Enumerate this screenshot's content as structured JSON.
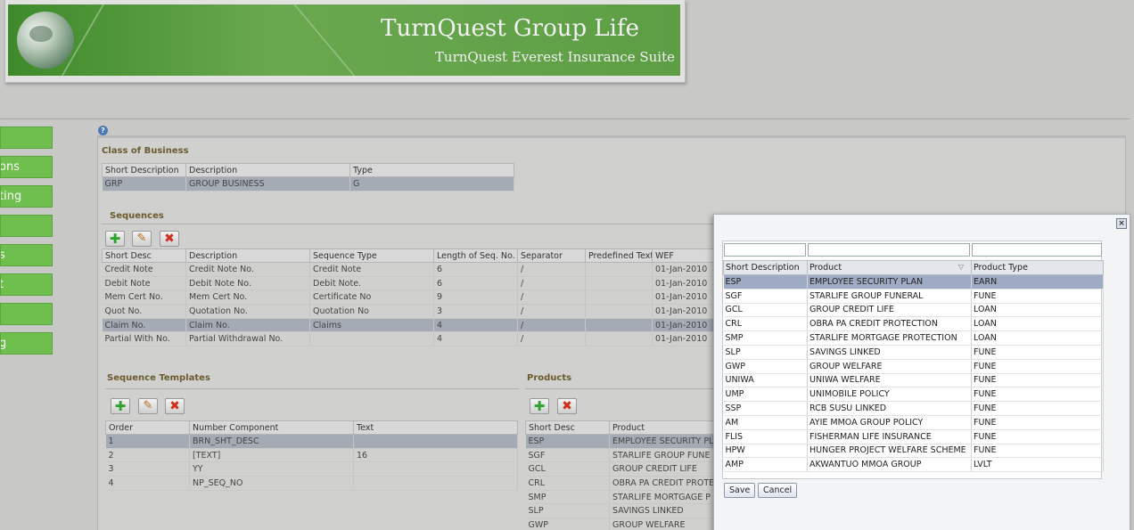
{
  "banner": {
    "title": "TurnQuest Group Life",
    "subtitle": "TurnQuest Everest Insurance Suite"
  },
  "nav": {
    "items": [
      {
        "label": ""
      },
      {
        "label": "ons"
      },
      {
        "label": "ting"
      },
      {
        "label": ""
      },
      {
        "label": "s"
      },
      {
        "label": "t"
      },
      {
        "label": ""
      },
      {
        "label": "g"
      }
    ]
  },
  "help": {
    "icon": "help-icon",
    "glyph": "?"
  },
  "class_of_business": {
    "title": "Class of Business",
    "columns": [
      "Short Description",
      "Description",
      "Type"
    ],
    "rows": [
      [
        "GRP",
        "GROUP BUSINESS",
        "G"
      ]
    ]
  },
  "sequences": {
    "title": "Sequences",
    "columns": [
      "Short Desc",
      "Description",
      "Sequence Type",
      "Length of Seq. No.",
      "Separator",
      "Predefined Text",
      "WEF"
    ],
    "rows": [
      [
        "Credit Note",
        "Credit Note No.",
        "Credit Note",
        "6",
        "/",
        "",
        "01-Jan-2010"
      ],
      [
        "Debit Note",
        "Debit Note No.",
        "Debit Note.",
        "6",
        "/",
        "",
        "01-Jan-2010"
      ],
      [
        "Mem Cert No.",
        "Mem Cert No.",
        "Certificate No",
        "9",
        "/",
        "",
        "01-Jan-2010"
      ],
      [
        "Quot No.",
        "Quotation No.",
        "Quotation No",
        "3",
        "/",
        "",
        "01-Jan-2010"
      ],
      [
        "Claim No.",
        "Claim No.",
        "Claims",
        "4",
        "/",
        "",
        "01-Jan-2010"
      ],
      [
        "Partial With No.",
        "Partial Withdrawal No.",
        "",
        "4",
        "/",
        "",
        "01-Jan-2010"
      ]
    ],
    "selected_row": 4
  },
  "sequence_templates": {
    "title": "Sequence Templates",
    "columns": [
      "Order",
      "Number Component",
      "Text"
    ],
    "rows": [
      [
        "1",
        "BRN_SHT_DESC",
        ""
      ],
      [
        "2",
        "[TEXT]",
        "16"
      ],
      [
        "3",
        "YY",
        ""
      ],
      [
        "4",
        "NP_SEQ_NO",
        ""
      ]
    ],
    "selected_row": 0
  },
  "products": {
    "title": "Products",
    "columns": [
      "Short Desc",
      "Product"
    ],
    "rows": [
      [
        "ESP",
        "EMPLOYEE SECURITY PL"
      ],
      [
        "SGF",
        "STARLIFE GROUP FUNE"
      ],
      [
        "GCL",
        "GROUP CREDIT LIFE"
      ],
      [
        "CRL",
        "OBRA PA CREDIT PROTE"
      ],
      [
        "SMP",
        "STARLIFE MORTGAGE P"
      ],
      [
        "SLP",
        "SAVINGS LINKED"
      ],
      [
        "GWP",
        "GROUP WELFARE"
      ]
    ],
    "selected_row": 0
  },
  "dialog": {
    "close_glyph": "×",
    "columns": [
      "Short Description",
      "Product",
      "Product Type"
    ],
    "sort_glyph": "▽",
    "rows": [
      [
        "ESP",
        "EMPLOYEE SECURITY PLAN",
        "EARN"
      ],
      [
        "SGF",
        "STARLIFE GROUP FUNERAL",
        "FUNE"
      ],
      [
        "GCL",
        "GROUP CREDIT LIFE",
        "LOAN"
      ],
      [
        "CRL",
        "OBRA PA CREDIT PROTECTION",
        "LOAN"
      ],
      [
        "SMP",
        "STARLIFE MORTGAGE PROTECTION",
        "LOAN"
      ],
      [
        "SLP",
        "SAVINGS LINKED",
        "FUNE"
      ],
      [
        "GWP",
        "GROUP WELFARE",
        "FUNE"
      ],
      [
        "UNIWA",
        "UNIWA WELFARE",
        "FUNE"
      ],
      [
        "UMP",
        "UNIMOBILE POLICY",
        "FUNE"
      ],
      [
        "SSP",
        "RCB SUSU LINKED",
        "FUNE"
      ],
      [
        "AM",
        "AYIE MMOA GROUP POLICY",
        "FUNE"
      ],
      [
        "FLIS",
        "FISHERMAN LIFE INSURANCE",
        "FUNE"
      ],
      [
        "HPW",
        "HUNGER PROJECT WELFARE SCHEME",
        "FUNE"
      ],
      [
        "AMP",
        "AKWANTUO MMOA GROUP",
        "LVLT"
      ]
    ],
    "selected_row": 0,
    "save_label": "Save",
    "cancel_label": "Cancel"
  },
  "toolbar_glyphs": {
    "add": "✚",
    "edit": "✎",
    "delete": "✖"
  }
}
